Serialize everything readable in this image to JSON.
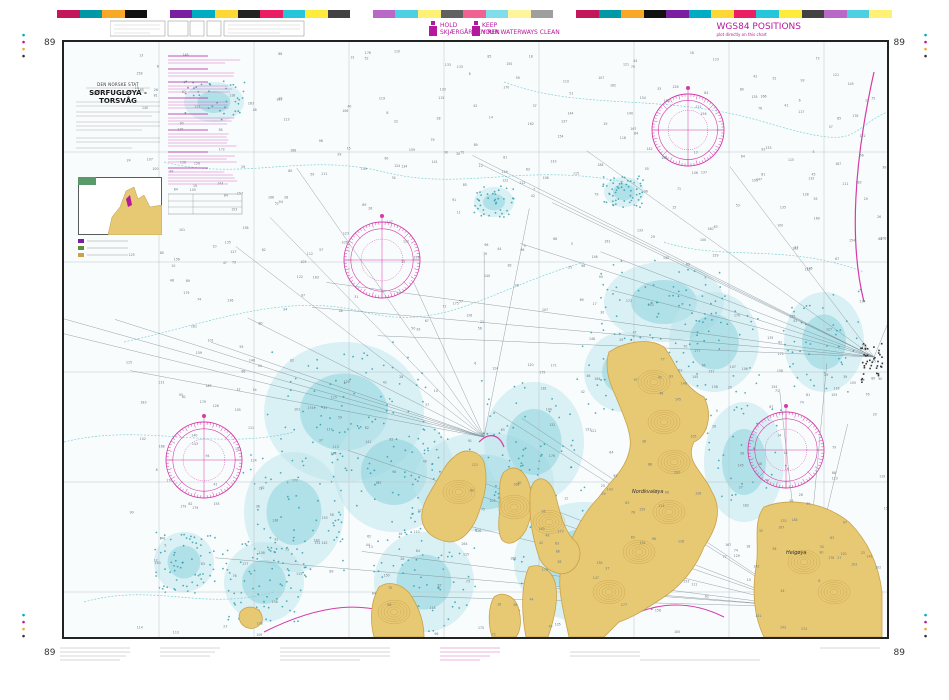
{
  "sheet": {
    "number_left": "89",
    "number_right": "89",
    "calibration_colors": [
      "#c2185b",
      "#0097a7",
      "#f9a825",
      "#111111",
      "#ffffff",
      "#7b1fa2",
      "#00acc1",
      "#fdd835",
      "#222222",
      "#e91e63",
      "#26c6da",
      "#ffeb3b",
      "#424242",
      "#ffffff",
      "#ba68c8",
      "#4dd0e1",
      "#fff176",
      "#616161",
      "#f06292",
      "#80deea",
      "#fff59d",
      "#9e9e9e",
      "#ffffff",
      "#c2185b",
      "#0097a7",
      "#f9a825",
      "#111111",
      "#7b1fa2",
      "#00acc1",
      "#fdd835",
      "#e91e63",
      "#26c6da",
      "#ffeb3b",
      "#424242",
      "#ba68c8",
      "#4dd0e1",
      "#fff176"
    ]
  },
  "header": {
    "slogan_no_1": "HOLD",
    "slogan_no_2": "SKJÆRGÅRDEN REN",
    "slogan_en_1": "KEEP",
    "slogan_en_2": "YOUR WATERWAYS CLEAN",
    "datum_title": "WGS84 POSITIONS",
    "datum_sub": "plot directly on this chart"
  },
  "titlebox": {
    "publisher": "DEN NORSKE STAT",
    "title": "SØRFUGLØYA - TORSVÅG"
  },
  "map": {
    "island_labels": [
      "Nordkvaløya",
      "Helgøya"
    ],
    "colors": {
      "water": "#f9fcfd",
      "shallow": "#bfe6ec",
      "shoal": "#7fcfd9",
      "land": "#e7c873",
      "land_dark": "#c9a24a",
      "magenta": "#d63aa8",
      "grid": "#b9c3c8"
    }
  }
}
